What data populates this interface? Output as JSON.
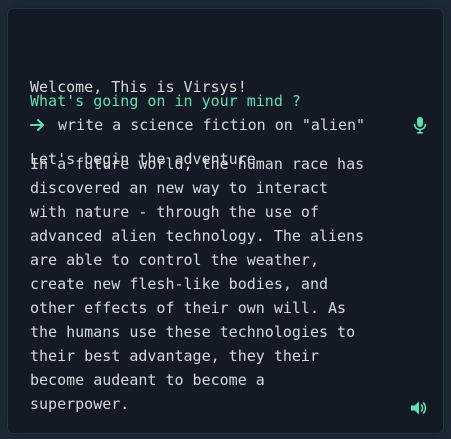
{
  "greeting": {
    "line1": "Welcome, This is Virsys!",
    "line2": "Let's begin the adventure"
  },
  "prompt": {
    "question": "What's going on in your mind ?",
    "input_text": "write a science fiction on \"alien\"",
    "arrow_icon": "arrow-right-icon",
    "mic_icon": "microphone-icon"
  },
  "response": {
    "lines": [
      "In a future world, the human race has",
      "discovered an new way to interact",
      "with nature - through the use of",
      "advanced alien technology. The aliens",
      "are able to control the weather,",
      "create new flesh-like bodies, and",
      "other effects of their own will. As",
      "the humans use these technologies to",
      "their best advantage, they their",
      "become audeant to become a",
      "superpower."
    ],
    "speaker_icon": "speaker-icon"
  },
  "colors": {
    "background": "#1d2a35",
    "panel": "#131a26",
    "text": "#d6d8da",
    "accent": "#5de0b0"
  }
}
